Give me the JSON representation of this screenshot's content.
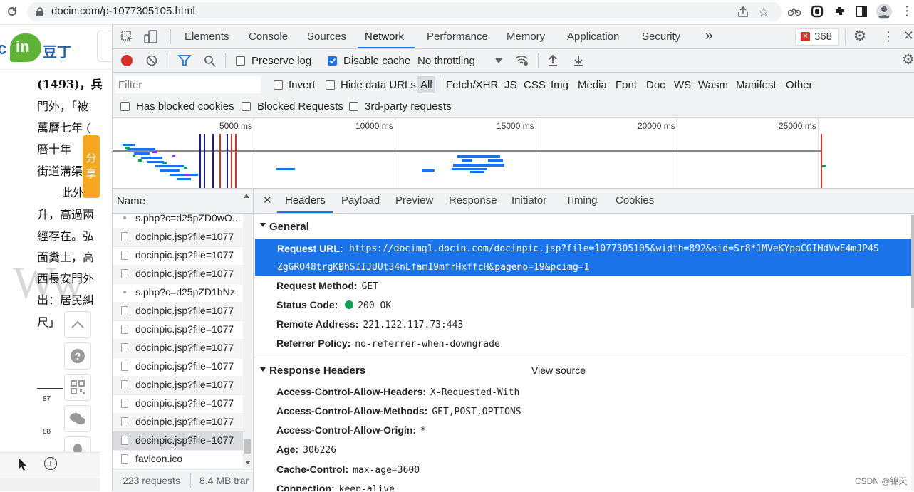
{
  "browser": {
    "url": "docin.com/p-1077305105.html"
  },
  "page": {
    "logo_text": "豆丁",
    "share_label": "分享",
    "lines": [
      "(1493)，兵",
      "門外，「被",
      "萬曆七年 (",
      "曆十年",
      "街道溝渠",
      "此外",
      "升，高過兩",
      "經存在。弘",
      "面糞土，高",
      "西長安門外",
      "出：居民糾",
      "尺」"
    ],
    "footnotes": [
      "87",
      "88"
    ]
  },
  "devtools": {
    "tabs": [
      "Elements",
      "Console",
      "Sources",
      "Network",
      "Performance",
      "Memory",
      "Application",
      "Security"
    ],
    "more_label": "»",
    "error_count": "368",
    "toolbar": {
      "preserve_log": "Preserve log",
      "disable_cache": "Disable cache",
      "throttling": "No throttling"
    },
    "filter": {
      "placeholder": "Filter",
      "invert": "Invert",
      "hide_data_urls": "Hide data URLs",
      "types": [
        "All",
        "Fetch/XHR",
        "JS",
        "CSS",
        "Img",
        "Media",
        "Font",
        "Doc",
        "WS",
        "Wasm",
        "Manifest",
        "Other"
      ],
      "has_blocked_cookies": "Has blocked cookies",
      "blocked_requests": "Blocked Requests",
      "third_party": "3rd-party requests"
    },
    "timeline": {
      "ticks": [
        "5000 ms",
        "10000 ms",
        "15000 ms",
        "20000 ms",
        "25000 ms"
      ]
    },
    "request_list": {
      "column": "Name",
      "items": [
        "s.php?c=d25pZD0wO...",
        "docinpic.jsp?file=1077",
        "docinpic.jsp?file=1077",
        "docinpic.jsp?file=1077",
        "s.php?c=d25pZD1hNz",
        "docinpic.jsp?file=1077",
        "docinpic.jsp?file=1077",
        "docinpic.jsp?file=1077",
        "docinpic.jsp?file=1077",
        "docinpic.jsp?file=1077",
        "docinpic.jsp?file=1077",
        "docinpic.jsp?file=1077",
        "docinpic.jsp?file=1077",
        "favicon.ico"
      ],
      "summary_requests": "223 requests",
      "summary_size": "8.4 MB trar"
    },
    "detail_tabs": [
      "Headers",
      "Payload",
      "Preview",
      "Response",
      "Initiator",
      "Timing",
      "Cookies"
    ],
    "general": {
      "title": "General",
      "request_url_label": "Request URL:",
      "request_url_line1": "https://docimg1.docin.com/docinpic.jsp?file=1077305105&width=892&sid=Sr8*1MVeKYpaCGIMdVwE4mJP4S",
      "request_url_line2": "ZgGRO48trgKBhSIIJUUt34nLfam19mfrHxffcH&pageno=19&pcimg=1",
      "request_method_label": "Request Method:",
      "request_method": "GET",
      "status_code_label": "Status Code:",
      "status_code": "200 OK",
      "remote_address_label": "Remote Address:",
      "remote_address": "221.122.117.73:443",
      "referrer_policy_label": "Referrer Policy:",
      "referrer_policy": "no-referrer-when-downgrade"
    },
    "response_headers": {
      "title": "Response Headers",
      "view_source": "View source",
      "items": [
        {
          "k": "Access-Control-Allow-Headers:",
          "v": "X-Requested-With"
        },
        {
          "k": "Access-Control-Allow-Methods:",
          "v": "GET,POST,OPTIONS"
        },
        {
          "k": "Access-Control-Allow-Origin:",
          "v": "*"
        },
        {
          "k": "Age:",
          "v": "306226"
        },
        {
          "k": "Cache-Control:",
          "v": "max-age=3600"
        },
        {
          "k": "Connection:",
          "v": "keep-alive"
        }
      ]
    }
  },
  "watermark": "CSDN @锦天",
  "colors": {
    "accent": "#1a73e8",
    "selected_row": "#1a73e8",
    "record": "#d93025",
    "status_ok": "#0f9d58",
    "logo_green": "#5fb336"
  }
}
